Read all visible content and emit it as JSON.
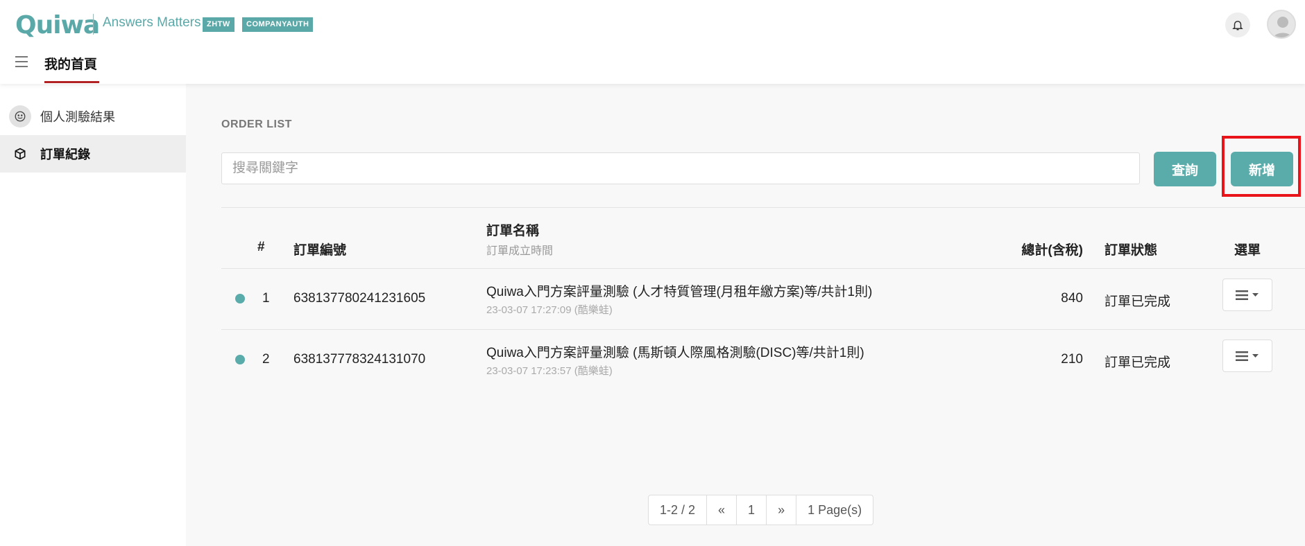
{
  "header": {
    "logo": "Quiwa",
    "slogan": "Answers Matters",
    "badges": [
      "ZHTW",
      "COMPANYAUTH"
    ],
    "home_tab": "我的首頁"
  },
  "sidebar": {
    "items": [
      {
        "label": "個人測驗結果",
        "icon": "smiley-icon"
      },
      {
        "label": "訂單紀錄",
        "icon": "box-icon"
      }
    ]
  },
  "main": {
    "title": "ORDER LIST",
    "search_placeholder": "搜尋關鍵字",
    "query_button": "查詢",
    "add_button": "新增",
    "columns": {
      "index": "#",
      "order_no": "訂單編號",
      "order_name": "訂單名稱",
      "order_time": "訂單成立時間",
      "total": "總計(含稅)",
      "status": "訂單狀態",
      "menu": "選單"
    },
    "rows": [
      {
        "index": "1",
        "order_no": "638137780241231605",
        "name": "Quiwa入門方案評量測驗 (人才特質管理(月租年繳方案)等/共計1則)",
        "time": "23-03-07 17:27:09 (酷樂蛙)",
        "total": "840",
        "status": "訂單已完成"
      },
      {
        "index": "2",
        "order_no": "638137778324131070",
        "name": "Quiwa入門方案評量測驗 (馬斯頓人際風格測驗(DISC)等/共計1則)",
        "time": "23-03-07 17:23:57 (酷樂蛙)",
        "total": "210",
        "status": "訂單已完成"
      }
    ]
  },
  "pagination": {
    "range": "1-2 / 2",
    "prev": "«",
    "current": "1",
    "next": "»",
    "pages": "1 Page(s)"
  },
  "colors": {
    "accent": "#5aacaa",
    "tab_underline": "#b12225",
    "highlight_box": "#e8141a"
  }
}
